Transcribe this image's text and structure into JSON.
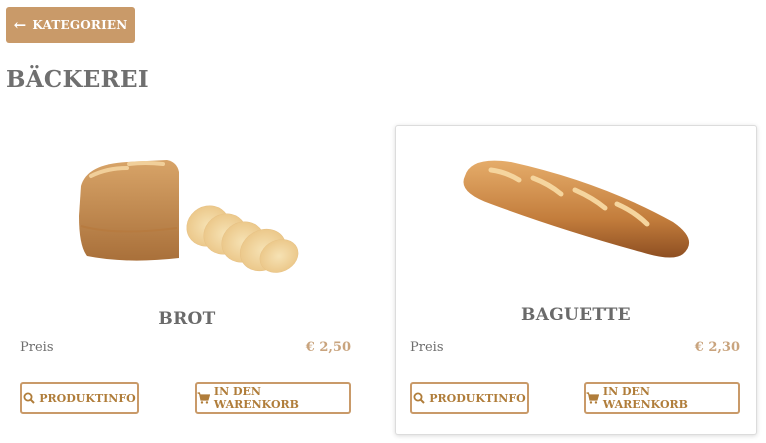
{
  "nav": {
    "back_label": "KATEGORIEN",
    "back_icon": "arrow-left-icon"
  },
  "page": {
    "title": "BÄCKEREI"
  },
  "products": [
    {
      "name": "BROT",
      "price_label": "Preis",
      "price": "€ 2,50",
      "info_label": "PRODUKTINFO",
      "cart_label": "IN DEN WARENKORB"
    },
    {
      "name": "BAGUETTE",
      "price_label": "Preis",
      "price": "€ 2,30",
      "info_label": "PRODUKTINFO",
      "cart_label": "IN DEN WARENKORB"
    }
  ],
  "colors": {
    "accent": "#c99a69",
    "button_text": "#b07d3a",
    "price": "#c9a47e",
    "title": "#6f6f6f"
  }
}
